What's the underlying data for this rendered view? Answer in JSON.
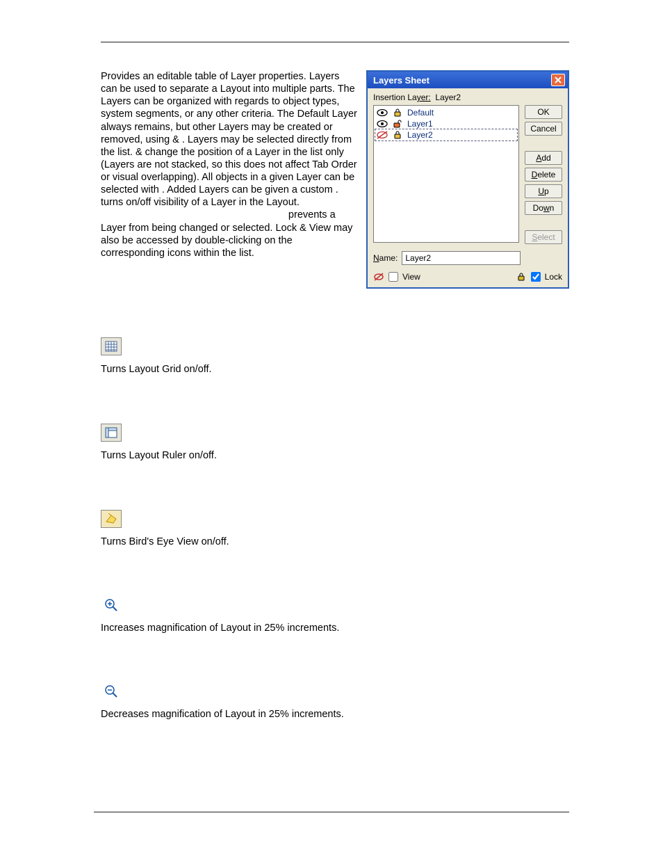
{
  "intro": "Provides an editable table of Layer properties. Layers can be used to separate a Layout into multiple parts. The Layers can be organized with regards to object types, system segments, or any other criteria. The Default Layer always remains, but other Layers may be created or removed, using           &          . Layers may be selected directly from the list.          &           change the position of a Layer in the list only (Layers are not stacked, so this does not affect Tab Order or visual overlapping). All objects in a given Layer can be selected with           . Added Layers can be given a custom          .           turns on/off visibility of a Layer in the Layout.",
  "intro_tail": "                                                                   prevents a Layer from being changed or selected. Lock & View may also be accessed by double-clicking on the corresponding icons within the list.",
  "dialog": {
    "title": "Layers Sheet",
    "insertion_label_a": "Insertion La",
    "insertion_label_b": "yer:",
    "insertion_value": "Layer2",
    "layers": [
      {
        "name": "Default",
        "visible": true,
        "locked": true,
        "selected": false
      },
      {
        "name": "Layer1",
        "visible": true,
        "locked": false,
        "selected": false
      },
      {
        "name": "Layer2",
        "visible": false,
        "locked": true,
        "selected": true
      }
    ],
    "buttons": {
      "ok": "OK",
      "cancel": "Cancel",
      "add": "Add",
      "delete": "Delete",
      "up": "Up",
      "down": "Down",
      "select": "Select"
    },
    "name_label_a": "N",
    "name_label_b": "ame:",
    "name_value": "Layer2",
    "view_label_a": "V",
    "view_label_b": "iew",
    "lock_label_a": "L",
    "lock_label_b": "ock",
    "view_checked": false,
    "lock_checked": true
  },
  "sections": {
    "grid": "Turns Layout Grid on/off.",
    "ruler": "Turns Layout Ruler on/off.",
    "birdseye": "Turns Bird's Eye View on/off.",
    "zoomin": "Increases magnification of Layout in 25% increments.",
    "zoomout": "Decreases magnification of Layout in 25% increments."
  }
}
